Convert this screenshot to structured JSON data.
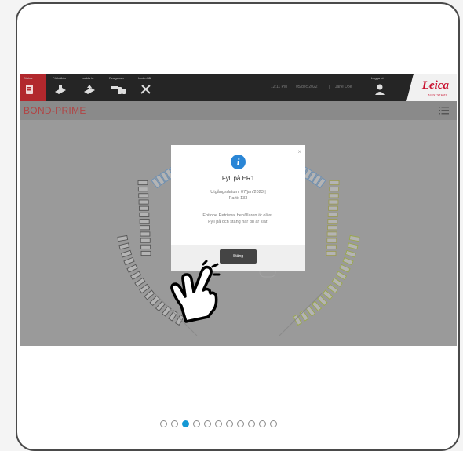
{
  "topbar": {
    "nav": [
      {
        "label": "Status",
        "icon": "status-icon"
      },
      {
        "label": "Förhållda",
        "icon": "tray-icon"
      },
      {
        "label": "Ladda in",
        "icon": "load-icon"
      },
      {
        "label": "Reagenser",
        "icon": "reagents-icon"
      },
      {
        "label": "Underhåll",
        "icon": "tools-icon"
      }
    ],
    "time": "12:11 PM",
    "date": "05/dec/2022",
    "user": "Jane Doe",
    "sep": "|",
    "logout": "Logga ut",
    "logo": "Leica",
    "logo_sub": "BIOSYSTEMS"
  },
  "subtitle": "BOND-PRIME",
  "dialog": {
    "close": "×",
    "icon_glyph": "i",
    "title": "Fyll på ER1",
    "expiry": "Utgångsdatum: 07/jan/2023  |",
    "lot": "Parti: 133",
    "message_1": "Epitope Retrieval behållaren är olåst.",
    "message_2": "Fyll på och stäng när du är klar.",
    "button": "Stäng"
  },
  "pagination": {
    "count": 11,
    "active_index": 2
  },
  "colors": {
    "accent_red": "#b2282d",
    "info_blue": "#2a86d6",
    "dot_active": "#1598d4"
  }
}
